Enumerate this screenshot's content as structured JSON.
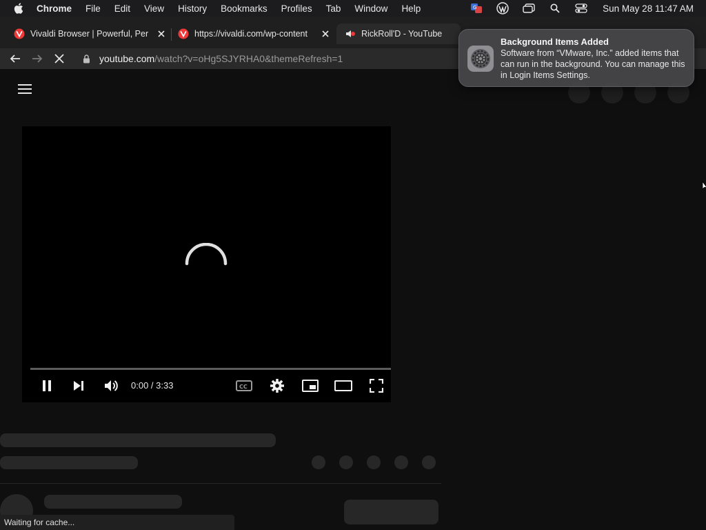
{
  "menubar": {
    "app": "Chrome",
    "items": [
      "File",
      "Edit",
      "View",
      "History",
      "Bookmarks",
      "Profiles",
      "Tab",
      "Window",
      "Help"
    ],
    "clock": "Sun May 28  11:47 AM",
    "tray_icons": [
      "translate-icon",
      "wordpress-icon",
      "window-stack-icon",
      "spotlight-search-icon",
      "control-center-icon"
    ]
  },
  "tabs": [
    {
      "title": "Vivaldi Browser | Powerful, Per",
      "icon": "vivaldi-icon",
      "active": false
    },
    {
      "title": "https://vivaldi.com/wp-content",
      "icon": "vivaldi-icon",
      "active": false
    },
    {
      "title": "RickRoll'D - YouTube",
      "icon": "audio-playing-icon",
      "active": true
    }
  ],
  "omnibox": {
    "host": "youtube.com",
    "path": "/watch?v=oHg5SJYRHA0&themeRefresh=1"
  },
  "player": {
    "time": "0:00 / 3:33",
    "progress": 0
  },
  "status_bar": "Waiting for cache...",
  "notification": {
    "title": "Background Items Added",
    "body": "Software from “VMware, Inc.” added items that can run in the background. You can manage this in Login Items Settings."
  },
  "colors": {
    "page_bg": "#0f0f0f",
    "skeleton": "#272727",
    "menubar_bg": "#1c1c1e",
    "vivaldi_red": "#ef3939"
  }
}
